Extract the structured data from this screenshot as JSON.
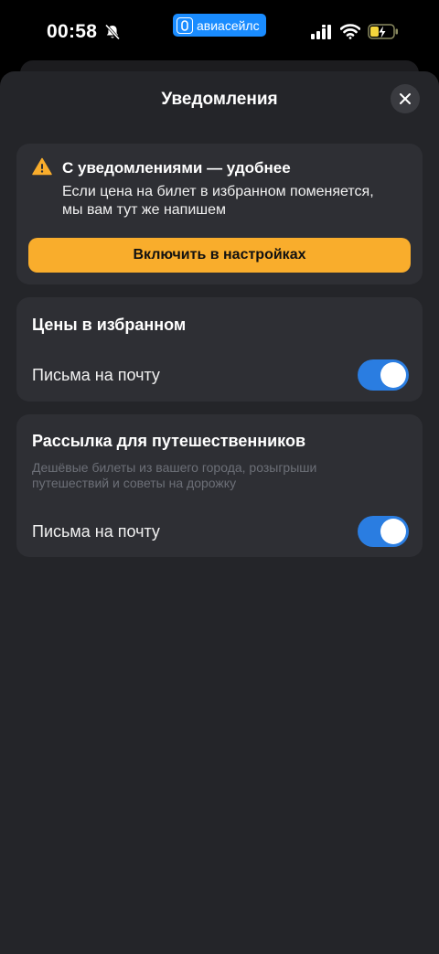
{
  "status_bar": {
    "time": "00:58",
    "app_label": "авиасейлс",
    "icons": [
      "bell-slash-icon",
      "cellular-signal-icon",
      "wifi-icon",
      "battery-charging-icon"
    ]
  },
  "sheet": {
    "title": "Уведомления",
    "close_icon": "close-icon"
  },
  "alert_card": {
    "icon": "warning-icon",
    "title": "С уведомлениями — удобнее",
    "text": "Если цена на билет в избранном поменяется, мы вам тут же напишем",
    "button_label": "Включить в настройках"
  },
  "prices_card": {
    "title": "Цены в избранном",
    "row_label": "Письма на почту",
    "toggle_on": true
  },
  "mailing_card": {
    "title": "Рассылка для путешественников",
    "subtitle": "Дешёвые билеты из вашего города, розыгрыши путешествий и советы на дорожку",
    "row_label": "Письма на почту",
    "toggle_on": true
  },
  "colors": {
    "accent_yellow": "#f9ad2c",
    "toggle_blue": "#2a7de1",
    "sheet_bg": "#242529",
    "card_bg": "#2e2f34",
    "app_pill_blue": "#1a8cff"
  }
}
